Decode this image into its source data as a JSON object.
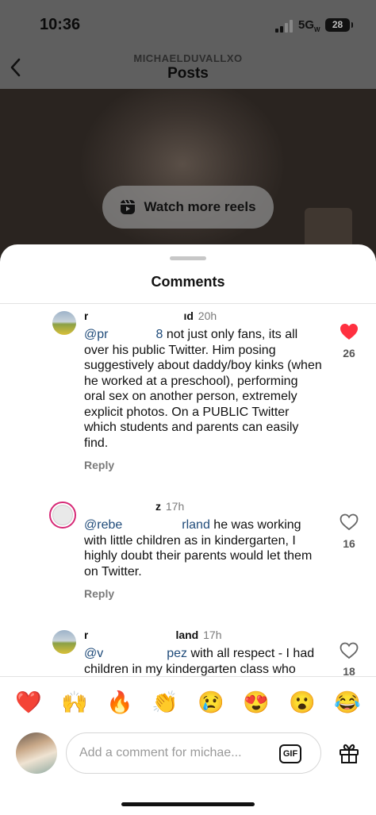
{
  "status_bar": {
    "time": "10:36",
    "network": "5G",
    "network_sub": "W",
    "battery": "28"
  },
  "header": {
    "account": "MICHAELDUVALLXO",
    "title": "Posts"
  },
  "post": {
    "reels_label": "Watch more reels"
  },
  "sheet": {
    "title": "Comments"
  },
  "comments": [
    {
      "user_start": "r",
      "user_end": "ıd",
      "time": "20h",
      "mention": "@pr",
      "mention_end": "8",
      "body": " not just only fans, its all over his public Twitter. Him posing suggestively about daddy/boy kinks (when he worked at a preschool), performing oral sex on another person, extremely explicit photos. On a PUBLIC Twitter which students and parents can easily find.",
      "reply": "Reply",
      "likes": "26",
      "liked": true
    },
    {
      "user_start": "",
      "user_end": "z",
      "time": "17h",
      "mention": "@rebe",
      "mention_end": "rland",
      "body": " he was working with little children as in kindergarten, I highly doubt their parents would let them on Twitter.",
      "reply": "Reply",
      "likes": "16",
      "liked": false
    },
    {
      "user_start": "r",
      "user_end": "land",
      "time": "17h",
      "mention": "@v",
      "mention_end": "pez",
      "body": " with all respect - I had children in my kindergarten class who",
      "reply": "",
      "likes": "18",
      "liked": false
    }
  ],
  "emoji_bar": [
    "❤️",
    "🙌",
    "🔥",
    "👏",
    "😢",
    "😍",
    "😮",
    "😂"
  ],
  "composer": {
    "placeholder": "Add a comment for michae...",
    "gif_label": "GIF"
  },
  "colors": {
    "like_red": "#ff3040",
    "mention_blue": "#1f4b7a",
    "story_ring": "#d62976"
  },
  "icons": {
    "back": "chevron-left-icon",
    "reels": "reels-icon",
    "heart": "heart-icon",
    "gift": "gift-icon"
  }
}
